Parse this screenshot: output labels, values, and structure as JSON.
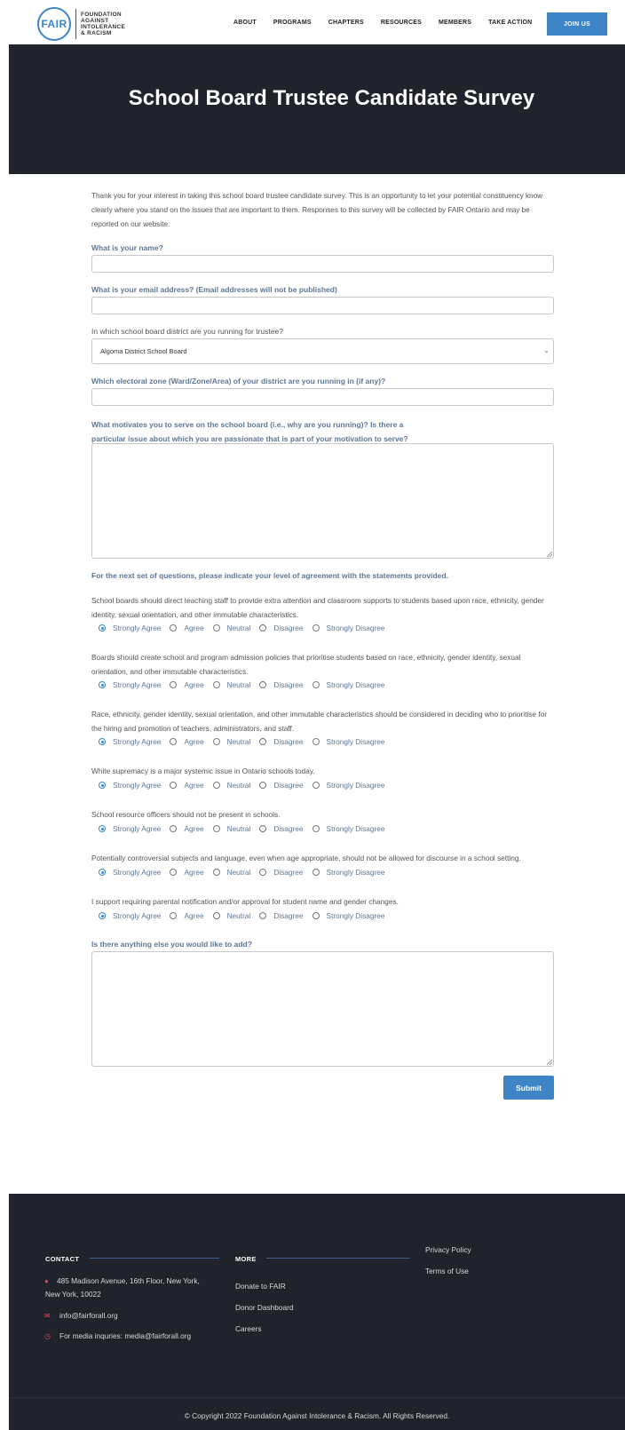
{
  "header": {
    "logo_mark": "FAIR",
    "logo_text": [
      "FOUNDATION",
      "AGAINST",
      "INTOLERANCE",
      "& RACISM"
    ],
    "nav": [
      "ABOUT",
      "PROGRAMS",
      "CHAPTERS",
      "RESOURCES",
      "MEMBERS",
      "TAKE ACTION"
    ],
    "join_label": "JOIN US"
  },
  "hero": {
    "title": "School Board Trustee Candidate Survey"
  },
  "form": {
    "intro": "Thank you for your interest in taking this school board trustee candidate survey.  This is an opportunity to let your potential constituency know clearly where you stand on the issues that are important to them.  Responses to this survey will be collected by FAIR Ontario and may be reported on our website.",
    "name_label": "What is your name?",
    "email_label": "What is your email address? (Email addresses will not be published)",
    "district_label": "In which school board district are you running for trustee?",
    "district_value": "Algoma District School Board",
    "zone_label": "Which electoral zone (Ward/Zone/Area) of your district are you running in (if any)?",
    "motivation_label": "What motivates you to serve on the school board (i.e., why are you running)? Is there a particular issue about which you are passionate that is part of your motivation to serve?",
    "agreement_intro": "For the next set of questions, please indicate your level of agreement with the statements provided.",
    "options": [
      "Strongly Agree",
      "Agree",
      "Neutral",
      "Disagree",
      "Strongly Disagree"
    ],
    "selected_option": "Strongly Agree",
    "questions": [
      "School boards should direct teaching staff to provide extra attention and classroom supports to students based upon race, ethnicity, gender identity, sexual orientation, and other immutable characteristics.",
      "Boards should create school and program admission policies that prioritise students based on race, ethnicity, gender identity, sexual orientation, and other immutable characteristics.",
      "Race, ethnicity, gender identity, sexual orientation, and other immutable characteristics should be considered in deciding who to prioritise for the hiring and promotion of teachers, administrators, and staff.",
      "White supremacy is a major systemic issue in Ontario schools today.",
      "School resource officers should not be present in schools.",
      "Potentially controversial subjects and language, even when age appropriate, should not be allowed for discourse in a school setting.",
      "I support requiring parental notification and/or approval for student name and gender changes."
    ],
    "additional_label": "Is there anything else you would like to add?",
    "submit_label": "Submit"
  },
  "footer": {
    "contact_heading": "CONTACT",
    "address": "485 Madison Avenue, 16th Floor, New York, New York, 10022",
    "email": "info@fairforall.org",
    "media": "For media inquries: media@fairforall.org",
    "more_heading": "MORE",
    "more_links": [
      "Donate to FAIR",
      "Donor Dashboard",
      "Careers"
    ],
    "legal_links": [
      "Privacy Policy",
      "Terms of Use"
    ],
    "copyright": "© Copyright 2022 Foundation Against Intolerance & Racism. All Rights Reserved."
  },
  "colors": {
    "accent": "#3d85c6",
    "dark": "#20222c",
    "label": "#5d7895",
    "footer_icon": "#e0474c"
  },
  "icons": [
    "map-pin-icon",
    "envelope-icon",
    "clock-icon",
    "chevron-down-icon",
    "resize-grip-icon"
  ]
}
